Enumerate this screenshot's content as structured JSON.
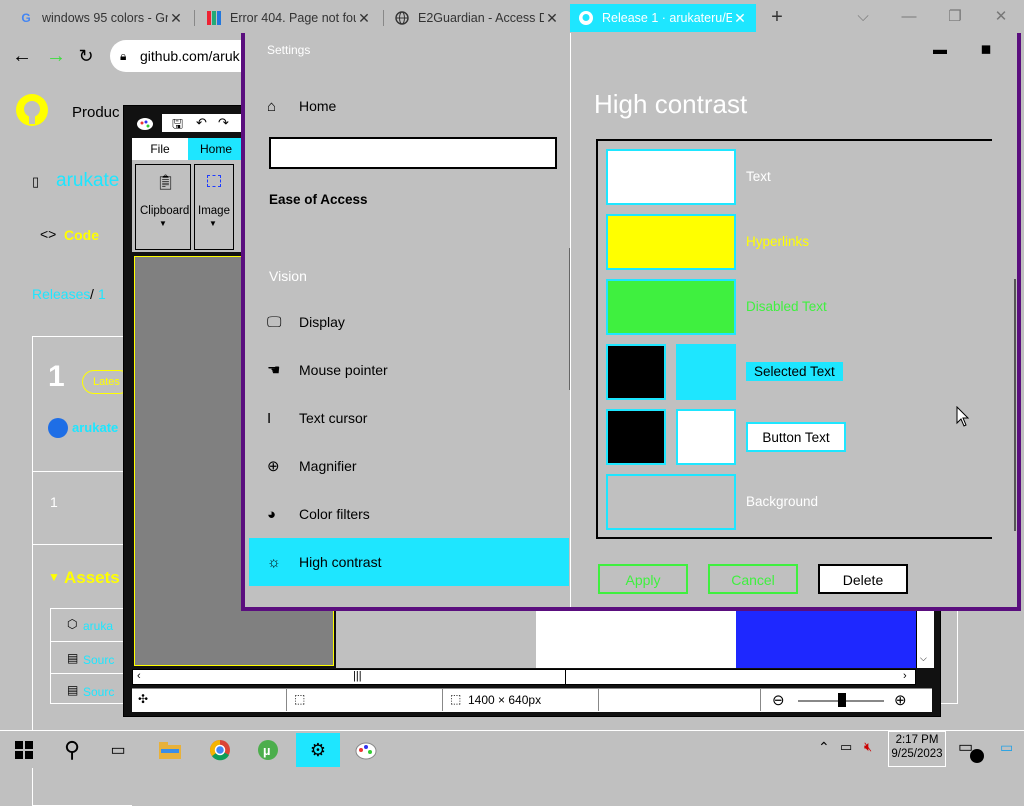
{
  "browser": {
    "tabs": [
      {
        "title": "windows 95 colors - Gr",
        "favicon": "google-icon"
      },
      {
        "title": "Error 404. Page not fou",
        "favicon": "page-icon"
      },
      {
        "title": "E2Guardian - Access D",
        "favicon": "globe-icon"
      },
      {
        "title": "Release 1 · arukateru/E",
        "favicon": "github-icon",
        "active": true
      }
    ],
    "address": "github.com/aruk",
    "new_tab": "+"
  },
  "github": {
    "product_menu": "Produc",
    "repo_owner": "arukate",
    "code_tab": "Code",
    "breadcrumb_releases": "Releases",
    "breadcrumb_sep": "/",
    "breadcrumb_tag": "1",
    "release_title": "1",
    "latest_badge": "Lates",
    "author": "arukate",
    "release_body": "1",
    "assets_heading": "Assets",
    "assets": [
      "aruka",
      "Sourc",
      "Sourc"
    ]
  },
  "paint": {
    "menu_file": "File",
    "menu_home": "Home",
    "group_clipboard": "Clipboard",
    "group_image": "Image",
    "status_size": "1400 × 640px"
  },
  "settings": {
    "window_title": "Settings",
    "nav_home": "Home",
    "search_value": "",
    "section": "Ease of Access",
    "group_vision": "Vision",
    "nav": [
      {
        "label": "Display",
        "icon": "display-icon"
      },
      {
        "label": "Mouse pointer",
        "icon": "mouse-pointer-icon"
      },
      {
        "label": "Text cursor",
        "icon": "text-cursor-icon"
      },
      {
        "label": "Magnifier",
        "icon": "magnifier-icon"
      },
      {
        "label": "Color filters",
        "icon": "color-filters-icon"
      },
      {
        "label": "High contrast",
        "icon": "high-contrast-icon",
        "selected": true
      }
    ],
    "page_title": "High contrast",
    "swatches": [
      {
        "label": "Text",
        "color": "#ffffff",
        "label_color": "#ffffff"
      },
      {
        "label": "Hyperlinks",
        "color": "#ffff00",
        "label_color": "#ffff00"
      },
      {
        "label": "Disabled Text",
        "color": "#3ff03f",
        "label_color": "#3ff03f"
      },
      {
        "label": "Selected Text",
        "fg": "#000000",
        "bg": "#1ee6ff"
      },
      {
        "label": "Button Text",
        "fg": "#000000",
        "bg": "#ffffff"
      },
      {
        "label": "Background",
        "color": "#c0c0c0",
        "label_color": "#ffffff"
      }
    ],
    "apply": "Apply",
    "cancel": "Cancel",
    "delete": "Delete"
  },
  "taskbar": {
    "time": "2:17 PM",
    "date": "9/25/2023"
  },
  "colors": {
    "accent": "#1ee6ff",
    "face": "#c0c0c0",
    "window_border": "#5a0e7e"
  }
}
